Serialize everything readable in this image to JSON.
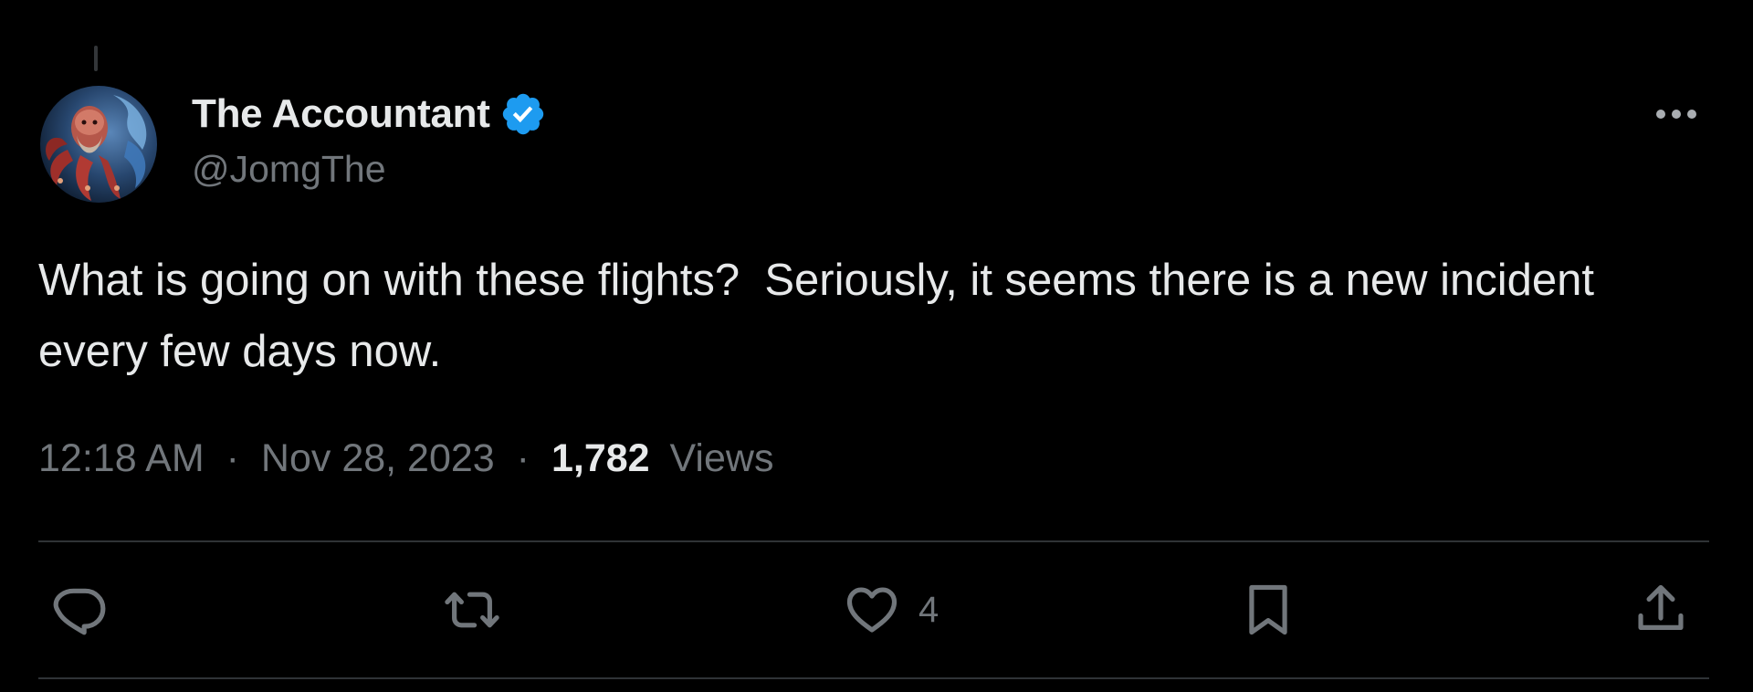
{
  "user": {
    "display_name": "The Accountant",
    "handle": "@JomgThe",
    "verified": true,
    "verified_color": "#1d9bf0",
    "avatar_icon": "avatar-octopus-warrior"
  },
  "tweet": {
    "text": "What is going on with these flights?  Seriously, it seems there is a new incident every few days now.",
    "time": "12:18 AM",
    "separator": "·",
    "date": "Nov 28, 2023",
    "views_count": "1,782",
    "views_label": "Views"
  },
  "actions": {
    "reply": {
      "icon": "reply-icon",
      "count": ""
    },
    "retweet": {
      "icon": "retweet-icon",
      "count": ""
    },
    "like": {
      "icon": "heart-icon",
      "count": "4"
    },
    "bookmark": {
      "icon": "bookmark-icon",
      "count": ""
    },
    "share": {
      "icon": "share-icon",
      "count": ""
    }
  },
  "menu": {
    "icon": "more-icon"
  },
  "colors": {
    "background": "#000000",
    "text_primary": "#e7e9ea",
    "text_secondary": "#71767b",
    "divider": "#2f3336"
  }
}
